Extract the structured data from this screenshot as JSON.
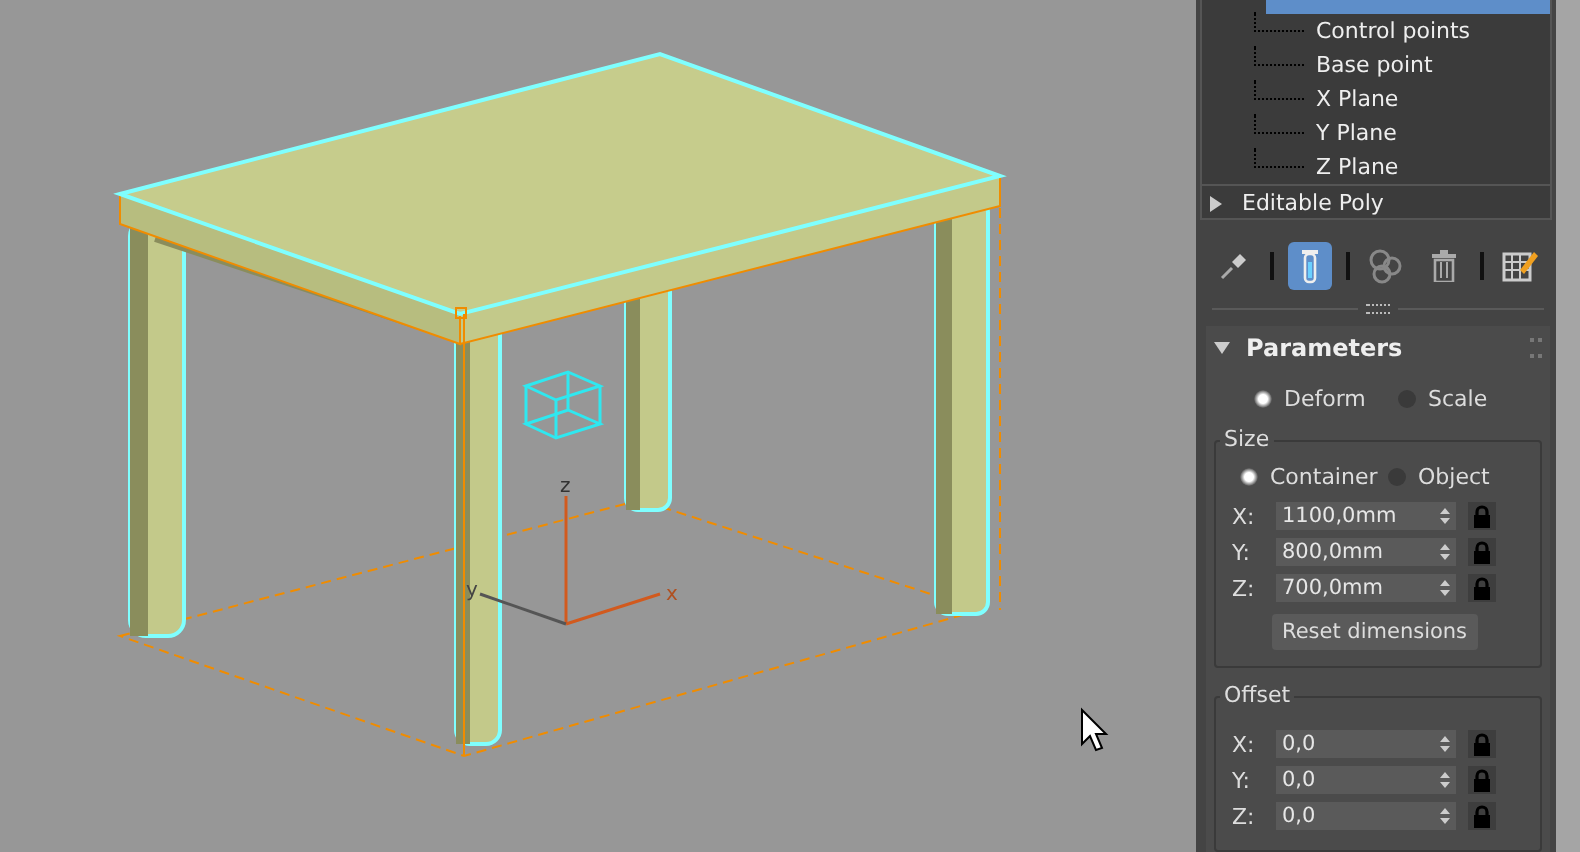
{
  "viewport": {
    "axis_labels": {
      "z": "z",
      "x": "x",
      "y": "y"
    }
  },
  "modifier_stack": [
    {
      "selected": true,
      "expanded": true,
      "children": [
        {
          "label": "Control points"
        },
        {
          "label": "Base point"
        },
        {
          "label": "X Plane"
        },
        {
          "label": "Y Plane"
        },
        {
          "label": "Z Plane"
        }
      ]
    },
    {
      "label": "Editable Poly",
      "selected": false,
      "expanded": false
    }
  ],
  "toolbar": [
    {
      "kind": "pin",
      "selected": false
    },
    {
      "kind": "separator"
    },
    {
      "kind": "tube",
      "selected": true
    },
    {
      "kind": "separator"
    },
    {
      "kind": "spheres",
      "selected": false
    },
    {
      "kind": "trash",
      "selected": false
    },
    {
      "kind": "separator"
    },
    {
      "kind": "edit",
      "selected": false
    }
  ],
  "parameters": {
    "title": "Parameters",
    "expanded": true,
    "mode": [
      {
        "label": "Deform",
        "selected": true
      },
      {
        "label": "Scale",
        "selected": false
      }
    ],
    "size": {
      "title": "Size",
      "radios": [
        {
          "label": "Container",
          "selected": true
        },
        {
          "label": "Object",
          "selected": false
        }
      ],
      "fields": [
        {
          "axis": "X:",
          "value": "1100,0mm"
        },
        {
          "axis": "Y:",
          "value": "800,0mm"
        },
        {
          "axis": "Z:",
          "value": "700,0mm"
        }
      ],
      "reset": "Reset dimensions"
    },
    "offset": {
      "title": "Offset",
      "fields": [
        {
          "axis": "X:",
          "value": "0,0"
        },
        {
          "axis": "Y:",
          "value": "0,0"
        },
        {
          "axis": "Z:",
          "value": "0,0"
        }
      ]
    }
  }
}
